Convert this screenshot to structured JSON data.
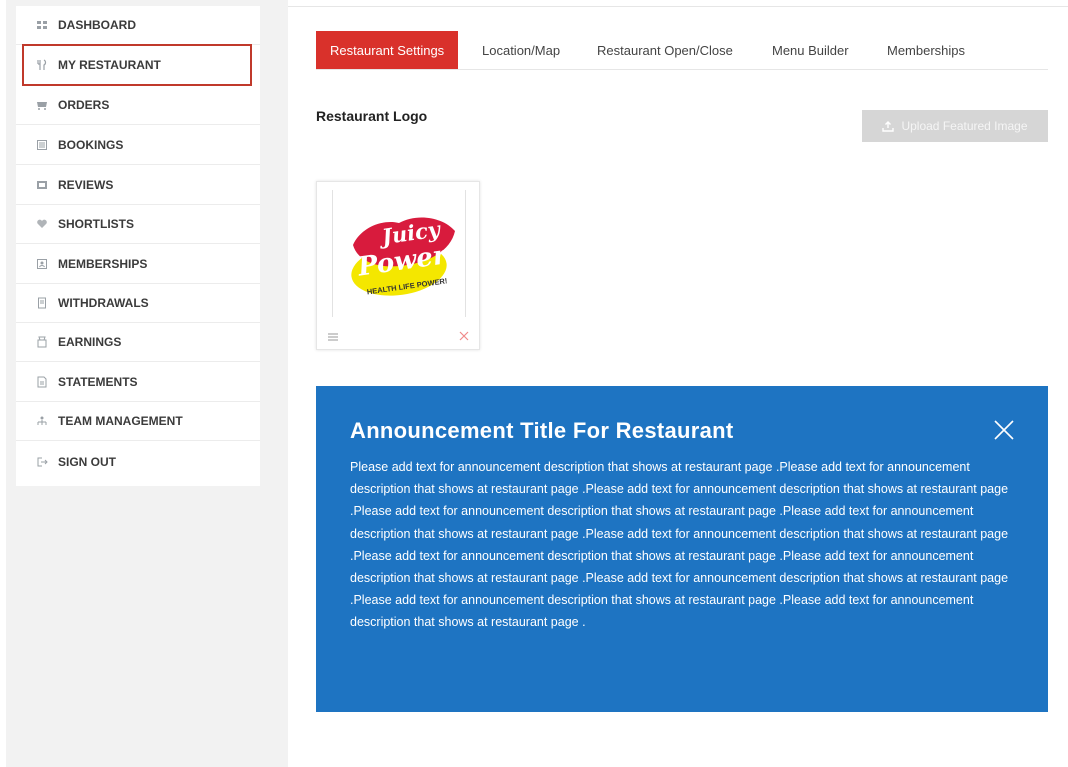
{
  "sidebar": {
    "items": [
      {
        "label": "DASHBOARD",
        "icon": "dashboard-icon"
      },
      {
        "label": "MY RESTAURANT",
        "icon": "restaurant-icon"
      },
      {
        "label": "ORDERS",
        "icon": "cart-icon"
      },
      {
        "label": "BOOKINGS",
        "icon": "bookings-icon"
      },
      {
        "label": "REVIEWS",
        "icon": "reviews-icon"
      },
      {
        "label": "SHORTLISTS",
        "icon": "heart-icon"
      },
      {
        "label": "MEMBERSHIPS",
        "icon": "memberships-icon"
      },
      {
        "label": "WITHDRAWALS",
        "icon": "withdrawals-icon"
      },
      {
        "label": "EARNINGS",
        "icon": "earnings-icon"
      },
      {
        "label": "STATEMENTS",
        "icon": "statements-icon"
      },
      {
        "label": "TEAM MANAGEMENT",
        "icon": "team-icon"
      },
      {
        "label": "SIGN OUT",
        "icon": "sign-out-icon"
      }
    ]
  },
  "tabs": [
    {
      "label": "Restaurant Settings",
      "active": true
    },
    {
      "label": "Location/Map",
      "active": false
    },
    {
      "label": "Restaurant Open/Close",
      "active": false
    },
    {
      "label": "Menu Builder",
      "active": false
    },
    {
      "label": "Memberships",
      "active": false
    }
  ],
  "logo_section": {
    "title": "Restaurant Logo",
    "upload_button": "Upload Featured Image",
    "logo_text": {
      "word1": "Juicy",
      "word2": "Power",
      "tagline": "HEALTH LIFE POWER!"
    }
  },
  "announcement": {
    "title": "Announcement Title For Restaurant",
    "body": "Please add text for announcement description that shows at restaurant page .Please add text for announcement description that shows at restaurant page .Please add text for announcement description that shows at restaurant page .Please add text for announcement description that shows at restaurant page .Please add text for announcement description that shows at restaurant page .Please add text for announcement description that shows at restaurant page .Please add text for announcement description that shows at restaurant page .Please add text for announcement description that shows at restaurant page .Please add text for announcement description that shows at restaurant page .Please add text for announcement description that shows at restaurant page .Please add text for announcement description that shows at restaurant page ."
  },
  "colors": {
    "accent_red": "#d9312b",
    "announcement_blue": "#1e74c2",
    "outline_red": "#c0392b"
  }
}
